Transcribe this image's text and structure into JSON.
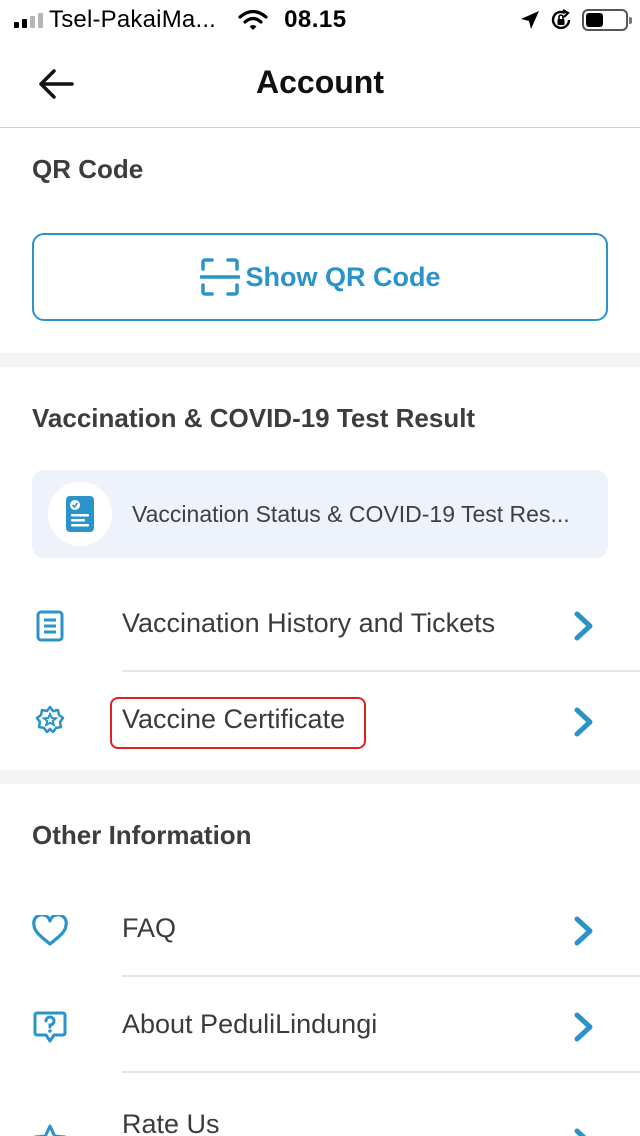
{
  "status_bar": {
    "carrier": "Tsel-PakaiMa...",
    "time": "08.15",
    "signal_bars_active": 2,
    "signal_bars_total": 4,
    "battery_level": 0.45,
    "icons": [
      "signal-icon",
      "wifi-icon",
      "location-arrow-icon",
      "orientation-lock-icon",
      "battery-icon"
    ]
  },
  "header": {
    "title": "Account",
    "back_icon": "arrow-left-icon"
  },
  "qr_section": {
    "title": "QR Code",
    "button_label": "Show QR Code",
    "button_icon": "qr-scan-icon"
  },
  "vaccination_section": {
    "title": "Vaccination & COVID-19 Test Result",
    "status_card_text": "Vaccination Status & COVID-19 Test Res...",
    "status_card_icon": "document-check-icon",
    "items": [
      {
        "label": "Vaccination History and Tickets",
        "icon": "clipboard-list-icon"
      },
      {
        "label": "Vaccine Certificate",
        "icon": "award-ribbon-icon",
        "highlighted": true
      }
    ]
  },
  "other_section": {
    "title": "Other Information",
    "items": [
      {
        "label": "FAQ",
        "icon": "heart-icon"
      },
      {
        "label": "About PeduliLindungi",
        "icon": "question-chat-icon"
      },
      {
        "label": "Rate Us",
        "icon": "star-icon"
      }
    ]
  },
  "colors": {
    "accent": "#2a93c9",
    "highlight": "#e0221f",
    "card_bg": "#eef2fb",
    "band_bg": "#f4f4f4"
  }
}
